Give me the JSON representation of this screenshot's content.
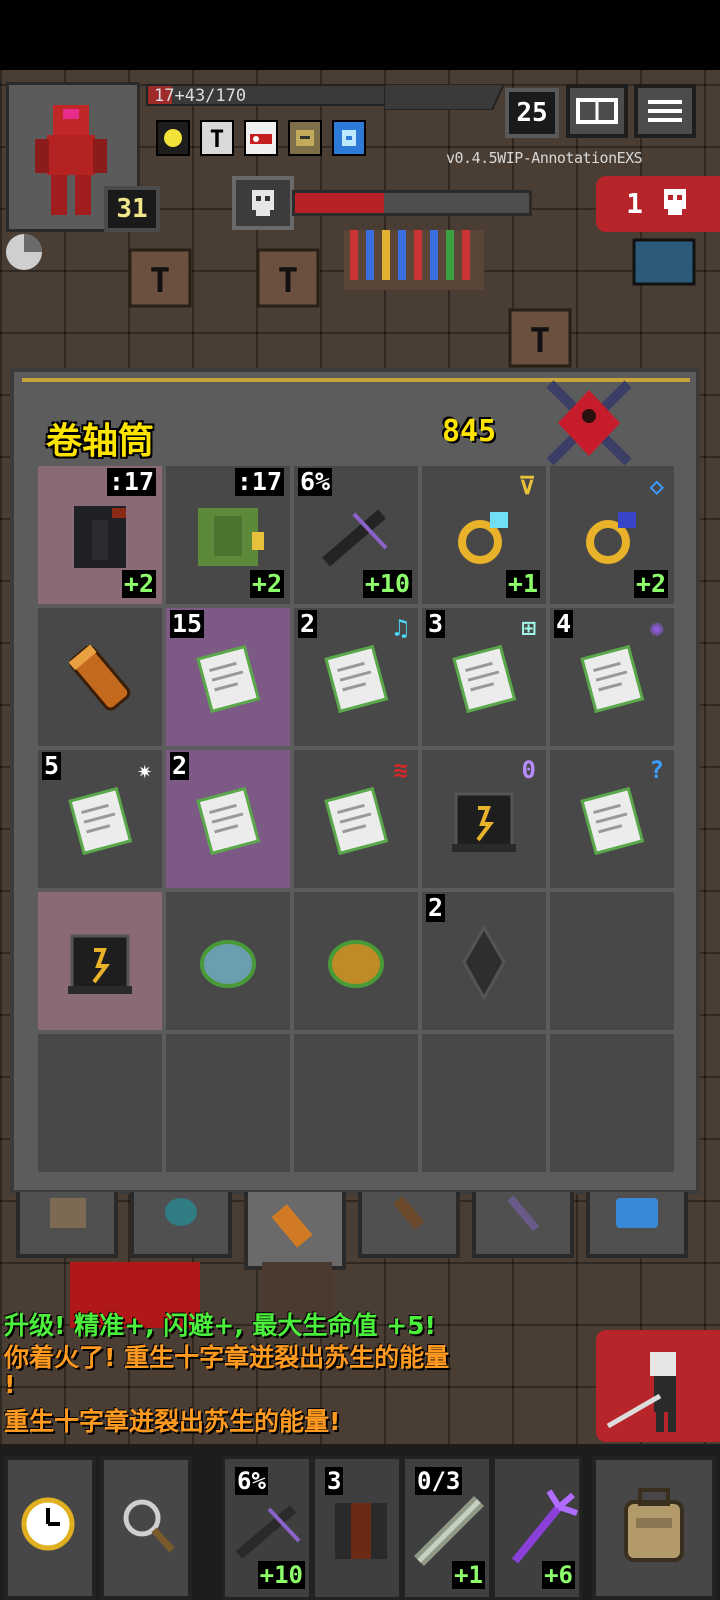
{
  "hud": {
    "hp_text": "17+43/170",
    "level": "31",
    "depth": "25",
    "version": "v0.4.5WIP-AnnotationEXS",
    "danger_count": "1"
  },
  "bag": {
    "title": "卷轴筒",
    "gold": "845",
    "rows": [
      [
        {
          "icon": "dark-helmet-icon",
          "style": "cursed",
          "tag": ":17",
          "level": "+2"
        },
        {
          "icon": "green-armor-icon",
          "style": "normal",
          "tag": ":17",
          "level": "+2"
        },
        {
          "icon": "crossbow-icon",
          "style": "normal",
          "qty": "6%",
          "level": "+10"
        },
        {
          "icon": "gold-ring-cyan-icon",
          "style": "normal",
          "mark": "⊽",
          "mark_color": "#e8c13a",
          "level": "+1"
        },
        {
          "icon": "gold-ring-blue-icon",
          "style": "normal",
          "mark": "◇",
          "mark_color": "#3aa0ff",
          "level": "+2"
        }
      ],
      [
        {
          "icon": "scroll-holder-icon",
          "style": "normal"
        },
        {
          "icon": "scroll-icon",
          "style": "magic",
          "qty": "15"
        },
        {
          "icon": "scroll-icon",
          "style": "normal",
          "qty": "2",
          "mark": "♫",
          "mark_color": "#4ad8ff"
        },
        {
          "icon": "scroll-icon",
          "style": "normal",
          "qty": "3",
          "mark": "⊞",
          "mark_color": "#9ff5e6"
        },
        {
          "icon": "scroll-icon",
          "style": "normal",
          "qty": "4",
          "mark": "✺",
          "mark_color": "#8a5cd8"
        }
      ],
      [
        {
          "icon": "scroll-icon",
          "style": "normal",
          "qty": "5",
          "mark": "✷",
          "mark_color": "#ffffff"
        },
        {
          "icon": "scroll-icon",
          "style": "magic",
          "qty": "2"
        },
        {
          "icon": "scroll-icon",
          "style": "normal",
          "mark": "≋",
          "mark_color": "#d62828"
        },
        {
          "icon": "spellbook-icon",
          "style": "normal",
          "mark": "0",
          "mark_color": "#b68cff"
        },
        {
          "icon": "scroll-icon",
          "style": "normal",
          "mark": "?",
          "mark_color": "#3aa0ff"
        }
      ],
      [
        {
          "icon": "spellbook-icon",
          "style": "cursed"
        },
        {
          "icon": "blue-seed-icon",
          "style": "normal"
        },
        {
          "icon": "orange-seed-icon",
          "style": "normal"
        },
        {
          "icon": "dark-crystal-icon",
          "style": "normal",
          "qty": "2"
        },
        {
          "icon": "",
          "style": "normal"
        }
      ],
      [
        {
          "icon": "",
          "style": "normal"
        },
        {
          "icon": "",
          "style": "normal"
        },
        {
          "icon": "",
          "style": "normal"
        },
        {
          "icon": "",
          "style": "normal"
        },
        {
          "icon": "",
          "style": "normal"
        }
      ]
    ]
  },
  "log": [
    {
      "text": "升级! 精准+, 闪避+, 最大生命值 +5!",
      "color": "#4cf03c"
    },
    {
      "text": "你着火了! 重生十字章迸裂出苏生的能量",
      "color": "#ff9a20"
    },
    {
      "text": "!",
      "color": "#ff9a20"
    },
    {
      "text": "重生十字章迸裂出苏生的能量!",
      "color": "#ff9a20"
    }
  ],
  "quickslots": [
    {
      "icon": "crossbow-icon",
      "tag": "6%",
      "level": "+10"
    },
    {
      "icon": "dark-armor-icon",
      "tag": "3",
      "level": ""
    },
    {
      "icon": "wand-icon",
      "tag": "0/3",
      "level": "+1"
    },
    {
      "icon": "purple-trident-icon",
      "tag": "",
      "level": "+6"
    }
  ],
  "colors": {
    "bag_bg": "#5c5c5c",
    "title_yellow": "#ffe400",
    "level_green": "#8cff6a",
    "danger_red": "#b7242a"
  }
}
